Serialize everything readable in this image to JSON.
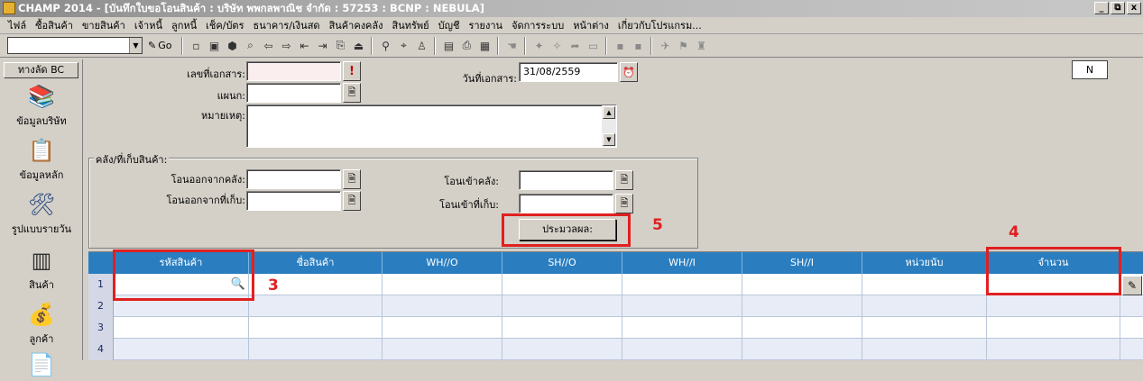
{
  "window": {
    "title": "CHAMP 2014 - [บันทึกใบขอโอนสินค้า : บริษัท พพกลพาณิช จำกัด : 57253 : BCNP : NEBULA]",
    "controls": [
      "_",
      "⧉",
      "x"
    ]
  },
  "menu": [
    "ไฟล์",
    "ซื้อสินค้า",
    "ขายสินค้า",
    "เจ้าหนี้",
    "ลูกหนี้",
    "เช็ค/บัตร",
    "ธนาคาร/เงินสด",
    "สินค้าคงคลัง",
    "สินทรัพย์",
    "บัญชี",
    "รายงาน",
    "จัดการระบบ",
    "หน้าต่าง",
    "เกี่ยวกับโปรแกรม..."
  ],
  "toolbar": {
    "combo_value": "",
    "go_label": "Go"
  },
  "sidebar": {
    "header": "ทางลัด BC",
    "items": [
      {
        "label": "ข้อมูลบริษัท",
        "icon": "books-icon"
      },
      {
        "label": "ข้อมูลหลัก",
        "icon": "document-icon"
      },
      {
        "label": "รูปแบบรายวัน",
        "icon": "tools-icon"
      },
      {
        "label": "สินค้า",
        "icon": "chip-icon"
      },
      {
        "label": "ลูกค้า",
        "icon": "money-bag-icon"
      }
    ]
  },
  "form": {
    "doc_no_label": "เลขที่เอกสาร:",
    "doc_no_value": "",
    "dept_label": "แผนก:",
    "dept_value": "",
    "remark_label": "หมายเหตุ:",
    "remark_value": "",
    "doc_date_label": "วันที่เอกสาร:",
    "doc_date_value": "31/08/2559",
    "status_box": "N",
    "group_title": "คลัง/ที่เก็บสินค้า:",
    "from_wh_label": "โอนออกจากคลัง:",
    "from_shelf_label": "โอนออกจากที่เก็บ:",
    "to_wh_label": "โอนเข้าคลัง:",
    "to_shelf_label": "โอนเข้าที่เก็บ:",
    "from_wh_value": "",
    "from_shelf_value": "",
    "to_wh_value": "",
    "to_shelf_value": "",
    "process_button": "ประมวลผล:"
  },
  "grid": {
    "columns": [
      "รหัสสินค้า",
      "ชื่อสินค้า",
      "WH//O",
      "SH//O",
      "WH//I",
      "SH//I",
      "หน่วยนับ",
      "จำนวน"
    ],
    "row_numbers": [
      "1",
      "2",
      "3",
      "4"
    ]
  },
  "annotations": [
    "3",
    "4",
    "5"
  ],
  "colors": {
    "grid_header": "#2a7ec0",
    "annotation": "#e02020"
  }
}
